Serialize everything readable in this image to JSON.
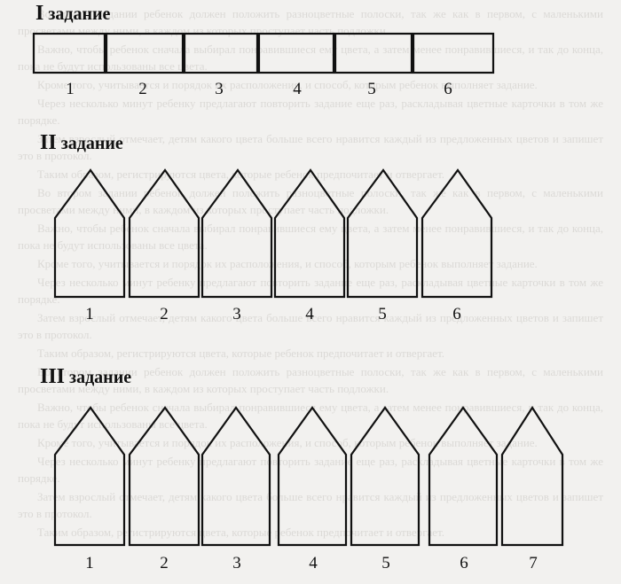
{
  "background_text": [
    "Во втором задании ребенок должен положить разноцветные полоски, так же как в первом, с маленькими просветами между ними, в каждом из которых проступает часть подложки.",
    "Важно, чтобы ребенок сначала выбирал понравившиеся ему цвета, а затем менее понравившиеся, и так до конца, пока не будут использованы все цвета.",
    "Кроме того, учитывается и порядок их расположения, и способ, которым ребенок выполняет задание.",
    "Через несколько минут ребенку предлагают повторить задание еще раз, раскладывая цветные карточки в том же порядке.",
    "Затем взрослый отмечает, детям какого цвета больше всего нравится каждый из предложенных цветов и запишет это в протокол.",
    "Таким образом, регистрируются цвета, которые ребенок предпочитает и отвергает."
  ],
  "tasks": [
    {
      "roman": "I",
      "word": "задание",
      "labels": [
        "1",
        "2",
        "3",
        "4",
        "5",
        "6"
      ]
    },
    {
      "roman": "II",
      "word": "задание",
      "labels": [
        "1",
        "2",
        "3",
        "4",
        "5",
        "6"
      ]
    },
    {
      "roman": "III",
      "word": "задание",
      "labels": [
        "1",
        "2",
        "3",
        "4",
        "5",
        "6",
        "7"
      ]
    }
  ]
}
